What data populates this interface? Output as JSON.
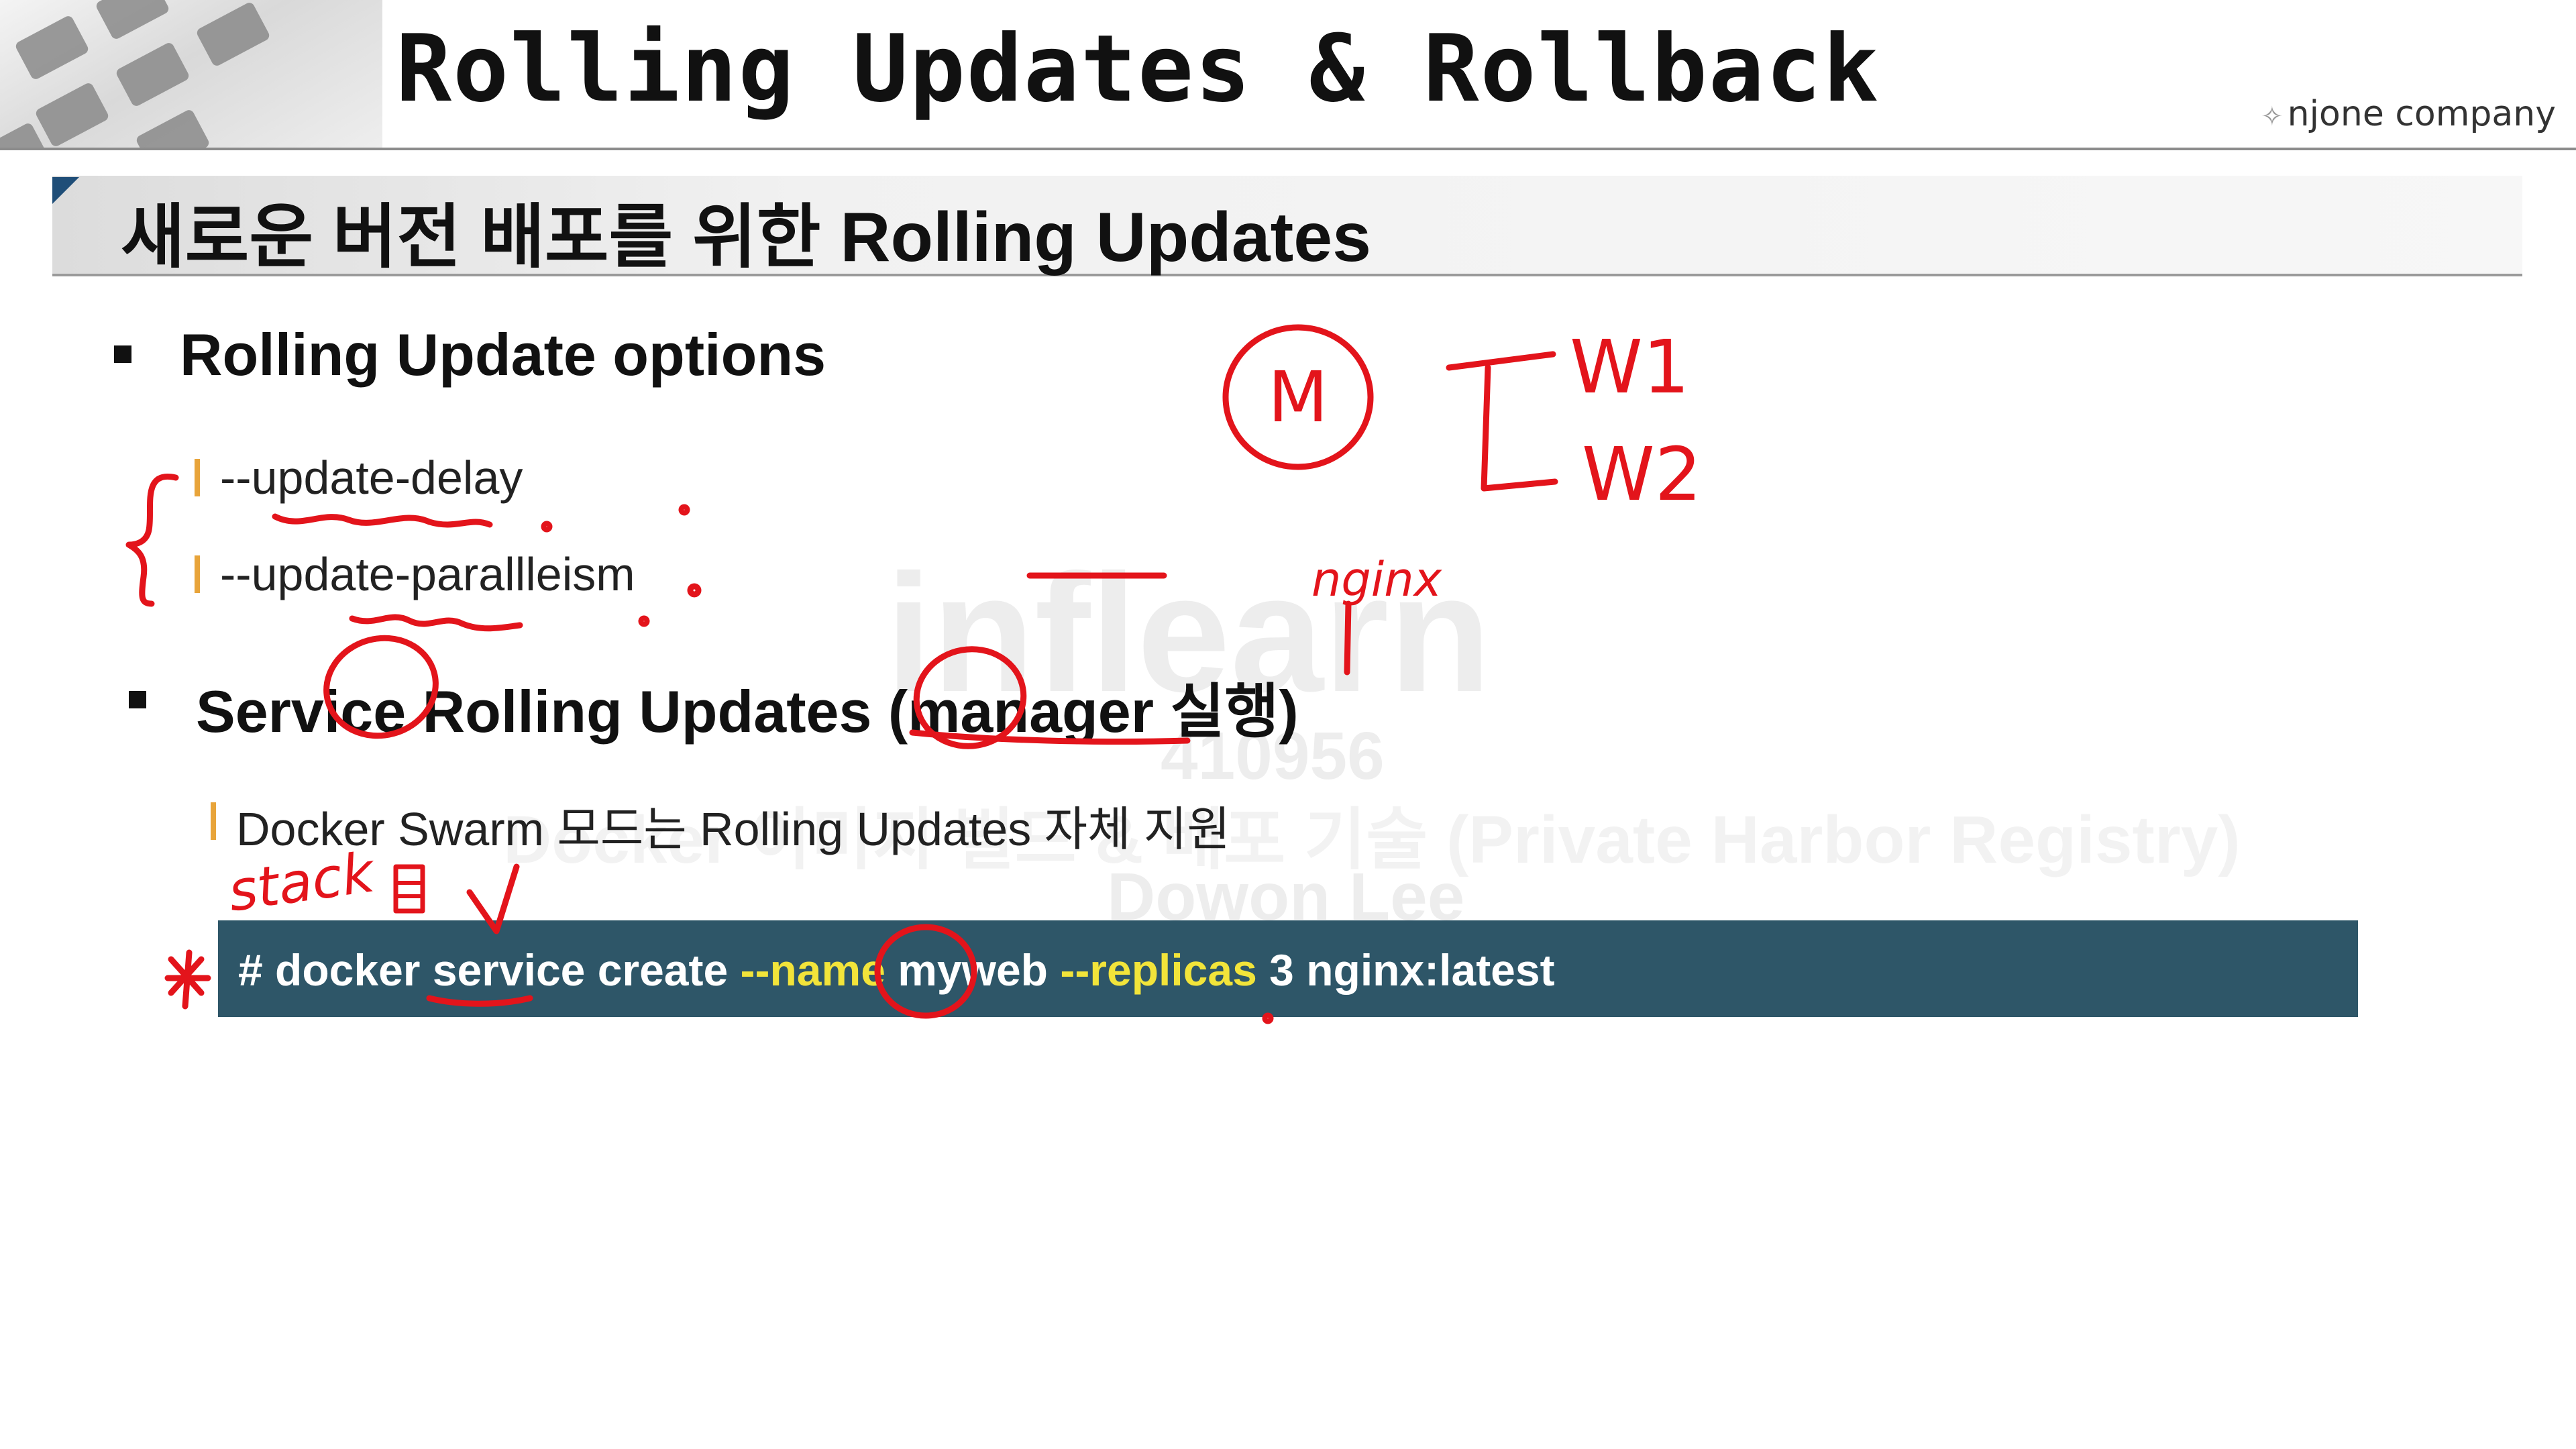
{
  "header": {
    "title": "Rolling Updates & Rollback",
    "brand": "njone company"
  },
  "section": {
    "heading": "새로운 버전 배포를 위한 Rolling Updates"
  },
  "bullets": [
    {
      "label": "Rolling Update options",
      "items": [
        "--update-delay",
        "--update-parallleism"
      ]
    },
    {
      "label": "Service Rolling Updates (manager 실행)",
      "items": [
        "Docker Swarm 모드는 Rolling Updates 자체 지원"
      ]
    }
  ],
  "command": {
    "parts": [
      "# docker service create ",
      "--name",
      " myweb ",
      "--replicas",
      " 3 nginx:latest"
    ]
  },
  "watermark": {
    "logo": "inflearn",
    "id": "410956",
    "course": "Docker 이미지 빌드 & 배포 기술 (Private Harbor Registry)",
    "author": "Dowon Lee"
  },
  "annotations": {
    "manager_node": "M",
    "worker_1": "W1",
    "worker_2": "W2",
    "service_image": "nginx",
    "stack_note": "stack"
  },
  "colors": {
    "command_bg": "#2e5668",
    "command_flag": "#f2e43a",
    "sub_bar": "#e8a43a",
    "annotation_ink": "#e3141b",
    "section_corner": "#1f4e78"
  }
}
